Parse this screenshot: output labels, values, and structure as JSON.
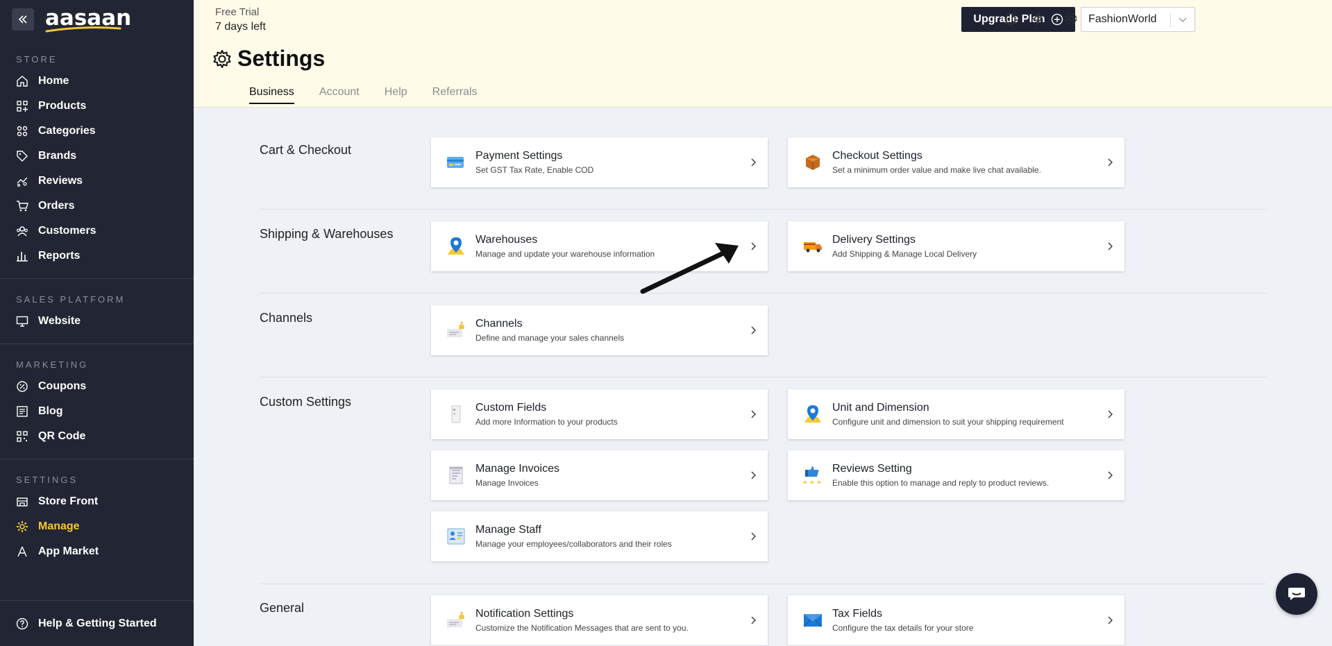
{
  "sidebar": {
    "logo": "aasaan",
    "sections": [
      {
        "title": "STORE",
        "items": [
          {
            "label": "Home",
            "icon": "home-icon"
          },
          {
            "label": "Products",
            "icon": "products-icon"
          },
          {
            "label": "Categories",
            "icon": "categories-icon"
          },
          {
            "label": "Brands",
            "icon": "tag-icon"
          },
          {
            "label": "Reviews",
            "icon": "reviews-icon"
          },
          {
            "label": "Orders",
            "icon": "cart-icon"
          },
          {
            "label": "Customers",
            "icon": "customers-icon"
          },
          {
            "label": "Reports",
            "icon": "reports-icon"
          }
        ]
      },
      {
        "title": "SALES PLATFORM",
        "items": [
          {
            "label": "Website",
            "icon": "monitor-icon"
          }
        ]
      },
      {
        "title": "MARKETING",
        "items": [
          {
            "label": "Coupons",
            "icon": "coupon-icon"
          },
          {
            "label": "Blog",
            "icon": "blog-icon"
          },
          {
            "label": "QR Code",
            "icon": "qr-icon"
          }
        ]
      },
      {
        "title": "SETTINGS",
        "items": [
          {
            "label": "Store Front",
            "icon": "storefront-icon"
          },
          {
            "label": "Manage",
            "icon": "gear-icon"
          },
          {
            "label": "App Market",
            "icon": "app-market-icon"
          }
        ]
      }
    ],
    "help": "Help & Getting Started"
  },
  "header": {
    "trial_label": "Free Trial",
    "trial_days": "7 days left",
    "upgrade": "Upgrade Plan",
    "store": "FashionWorld",
    "title": "Settings",
    "tabs": [
      "Business",
      "Account",
      "Help",
      "Referrals"
    ],
    "active_tab": "Business"
  },
  "sections": [
    {
      "label": "Cart & Checkout"
    },
    {
      "label": "Shipping & Warehouses"
    },
    {
      "label": "Channels"
    },
    {
      "label": "Custom Settings"
    },
    {
      "label": "General"
    }
  ],
  "cards": {
    "payment": {
      "title": "Payment Settings",
      "desc": "Set GST Tax Rate, Enable COD"
    },
    "checkout": {
      "title": "Checkout Settings",
      "desc": "Set a minimum order value and make live chat available."
    },
    "warehouses": {
      "title": "Warehouses",
      "desc": "Manage and update your warehouse information"
    },
    "delivery": {
      "title": "Delivery Settings",
      "desc": "Add Shipping & Manage Local Delivery"
    },
    "channels": {
      "title": "Channels",
      "desc": "Define and manage your sales channels"
    },
    "custom_fields": {
      "title": "Custom Fields",
      "desc": "Add more Information to your products"
    },
    "unit": {
      "title": "Unit and Dimension",
      "desc": "Configure unit and dimension to suit your shipping requirement"
    },
    "invoices": {
      "title": "Manage Invoices",
      "desc": "Manage Invoices"
    },
    "reviews": {
      "title": "Reviews Setting",
      "desc": "Enable this option to manage and reply to product reviews."
    },
    "staff": {
      "title": "Manage Staff",
      "desc": "Manage your employees/collaborators and their roles"
    },
    "notification": {
      "title": "Notification Settings",
      "desc": "Customize the Notification Messages that are sent to you."
    },
    "tax": {
      "title": "Tax Fields",
      "desc": "Configure the tax details for your store"
    }
  },
  "colors": {
    "sidebar_bg": "#222533",
    "active_accent": "#f6c933",
    "header_bg": "#fefbe9",
    "content_bg": "#eef1f5",
    "button_dark": "#1f2233"
  }
}
